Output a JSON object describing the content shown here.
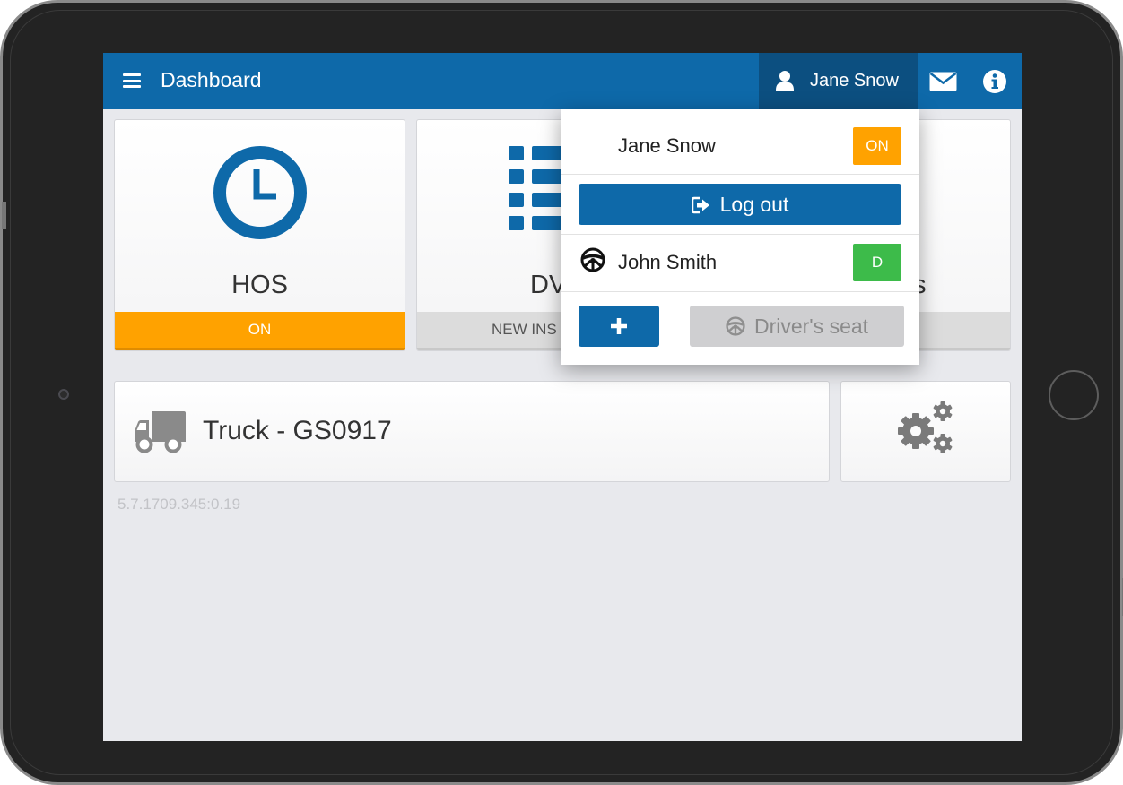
{
  "header": {
    "title": "Dashboard",
    "user_name": "Jane Snow"
  },
  "tiles": {
    "hos": {
      "label": "HOS",
      "status": "ON"
    },
    "dvir": {
      "label": "DV",
      "status": "NEW INS"
    },
    "third": {
      "label": "s"
    }
  },
  "vehicle": {
    "label": "Truck - GS0917"
  },
  "version": "5.7.1709.345:0.19",
  "user_menu": {
    "current_user": {
      "name": "Jane Snow",
      "status": "ON"
    },
    "logout_label": "Log out",
    "co_driver": {
      "name": "John Smith",
      "status": "D"
    },
    "add_label": "+",
    "drivers_seat_label": "Driver's seat"
  },
  "colors": {
    "primary": "#0e69a9",
    "header_dark": "#0c4f80",
    "status_on": "#ffa200",
    "status_driving": "#3dbb4a",
    "background": "#e8e9ed"
  },
  "icons": [
    "menu-icon",
    "user-icon",
    "mail-icon",
    "info-icon",
    "clock-icon",
    "list-icon",
    "truck-icon",
    "gears-icon",
    "logout-icon",
    "steering-wheel-icon",
    "plus-icon"
  ]
}
